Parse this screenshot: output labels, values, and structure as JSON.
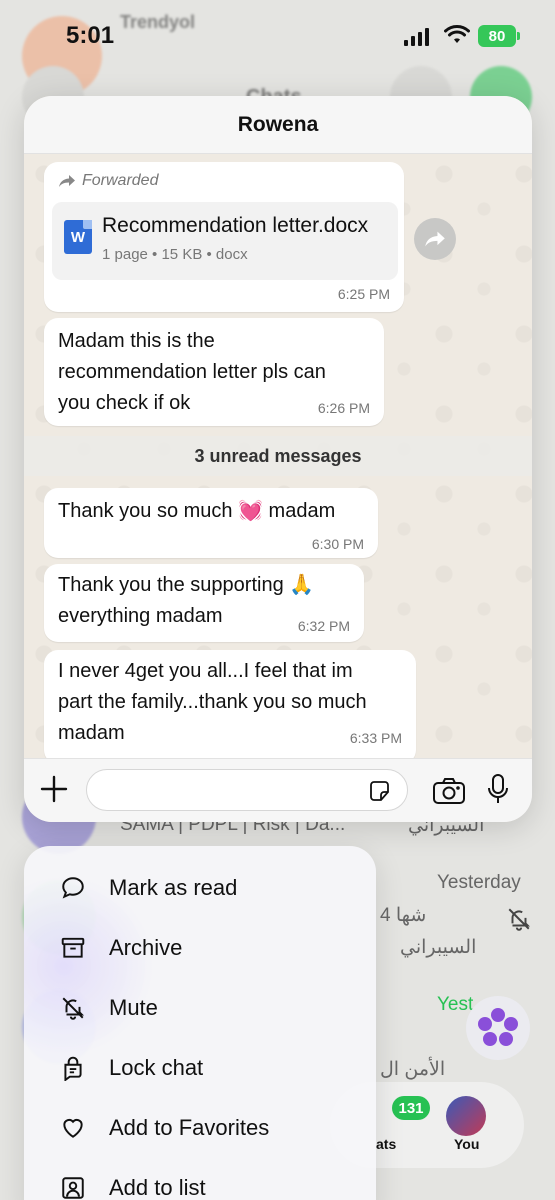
{
  "status_bar": {
    "time": "5:01",
    "battery": "80"
  },
  "background": {
    "top_title": "Trendyol",
    "header_title": "Chats",
    "row_snippet_1": "SAMA | PDPL | Risk | Da...",
    "row_time_1": "Yesterday",
    "row_snippet_arabic_1": "4 شها",
    "row_snippet_arabic_2": "السيبراني",
    "row_snippet_arabic_3": "السيبراني",
    "row_time_2": "Yest",
    "row_snippet_arabic_4": "الأمن ال",
    "nav_badge": "131",
    "nav_chats": "ats",
    "nav_you": "You"
  },
  "preview": {
    "contact_name": "Rowena",
    "forwarded_label": "Forwarded",
    "document": {
      "name": "Recommendation letter.docx",
      "meta": "1 page • 15 KB • docx",
      "icon_letter": "W",
      "time": "6:25 PM"
    },
    "messages": [
      {
        "lines": [
          "Madam this is the",
          "recommendation letter  pls can",
          "you check if ok"
        ],
        "time": "6:26 PM"
      },
      {
        "lines": [
          "Thank you so much 💓 madam"
        ],
        "time": "6:30 PM"
      },
      {
        "lines": [
          "Thank you the supporting 🙏",
          "everything madam"
        ],
        "time": "6:32 PM"
      },
      {
        "lines": [
          "I never 4get you all...I feel that im",
          "part the family...thank you so much",
          "madam"
        ],
        "time": "6:33 PM"
      }
    ],
    "unread_banner": "3 unread messages",
    "input_placeholder": ""
  },
  "context_menu": {
    "items": [
      {
        "label": "Mark as read",
        "icon": "chat-bubble-icon"
      },
      {
        "label": "Archive",
        "icon": "archive-icon"
      },
      {
        "label": "Mute",
        "icon": "bell-slash-icon"
      },
      {
        "label": "Lock chat",
        "icon": "lock-chat-icon"
      },
      {
        "label": "Add to Favorites",
        "icon": "heart-icon"
      },
      {
        "label": "Add to list",
        "icon": "add-to-list-icon"
      }
    ]
  },
  "colors": {
    "accent_green": "#27c153",
    "doc_blue": "#2f6cd6",
    "chat_bg": "#efeae2"
  }
}
